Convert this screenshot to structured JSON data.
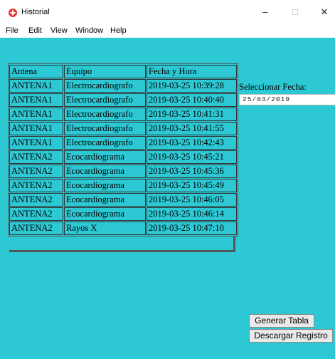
{
  "window": {
    "title": "Historial"
  },
  "window_controls": {
    "minimize": "–",
    "maximize": "□",
    "close": "✕"
  },
  "menu": [
    "File",
    "Edit",
    "View",
    "Window",
    "Help"
  ],
  "table": {
    "headers": [
      "Antena",
      "Equipo",
      "Fecha y Hora"
    ],
    "rows": [
      [
        "ANTENA1",
        "Electrocardiografo",
        "2019-03-25 10:39:28"
      ],
      [
        "ANTENA1",
        "Electrocardiografo",
        "2019-03-25 10:40:40"
      ],
      [
        "ANTENA1",
        "Electrocardiografo",
        "2019-03-25 10:41:31"
      ],
      [
        "ANTENA1",
        "Electrocardiografo",
        "2019-03-25 10:41:55"
      ],
      [
        "ANTENA1",
        "Electrocardiografo",
        "2019-03-25 10:42:43"
      ],
      [
        "ANTENA2",
        "Ecocardiograma",
        "2019-03-25 10:45:21"
      ],
      [
        "ANTENA2",
        "Ecocardiograma",
        "2019-03-25 10:45:36"
      ],
      [
        "ANTENA2",
        "Ecocardiograma",
        "2019-03-25 10:45:49"
      ],
      [
        "ANTENA2",
        "Ecocardiograma",
        "2019-03-25 10:46:05"
      ],
      [
        "ANTENA2",
        "Ecocardiograma",
        "2019-03-25 10:46:14"
      ],
      [
        "ANTENA2",
        "Rayos X",
        "2019-03-25 10:47:10"
      ]
    ]
  },
  "date_picker": {
    "label": "Seleccionar Fecha:",
    "value": "25/03/2019"
  },
  "buttons": {
    "generate": "Generar Tabla",
    "download": "Descargar Registro"
  },
  "colors": {
    "background": "#2cc8d4",
    "app_icon": "#e53935"
  },
  "icons": {
    "app": "red-cross-icon"
  }
}
